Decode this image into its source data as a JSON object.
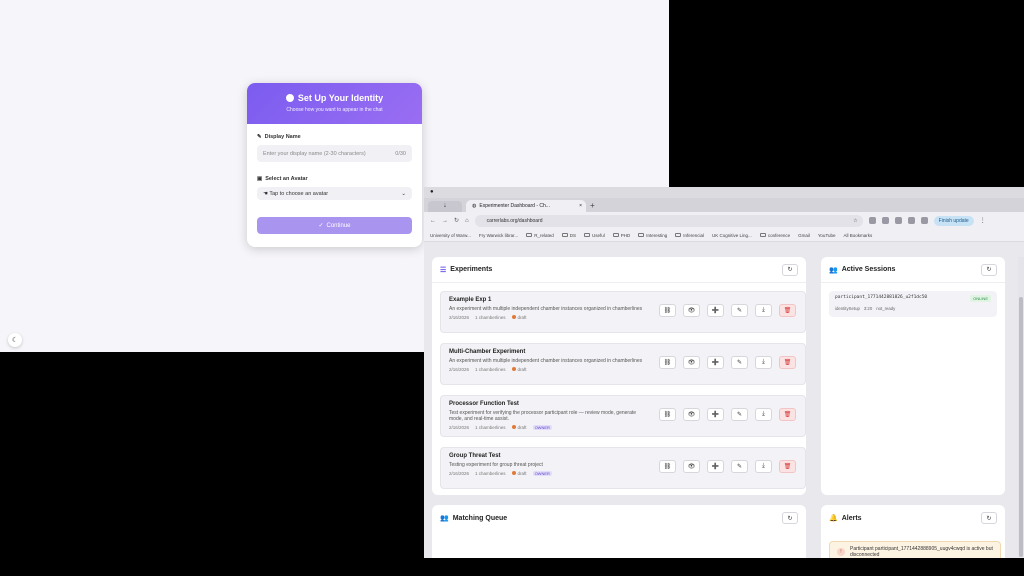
{
  "identity": {
    "title": "Set Up Your Identity",
    "subtitle": "Choose how you want to appear in the chat",
    "display_name_label": "Display Name",
    "display_name_placeholder": "Enter your display name (2-30 characters)",
    "char_count": "0/30",
    "avatar_label": "Select an Avatar",
    "avatar_value": "Tap to choose an avatar",
    "continue_label": "Continue"
  },
  "browser": {
    "tab_small": "⇣",
    "tab_title": "Experimenter Dashboard - Ch...",
    "url": "carrerlabs.org/dashboard",
    "finish_update": "Finish update",
    "bookmarks": [
      "University of Warw...",
      "Fry Warwick librar...",
      "R_related",
      "DS",
      "Useful",
      "PHD",
      "Interesting",
      "Inferencial",
      "UK Cognitive Ling...",
      "conference",
      "Gmail",
      "YouTube"
    ],
    "all_bookmarks": "All Bookmarks"
  },
  "experiments": {
    "title": "Experiments",
    "items": [
      {
        "name": "Example Exp 1",
        "desc": "An experiment with multiple independent chamber instances organized in chamberlines",
        "date": "2/16/2026",
        "chambers": "1 chamberlines",
        "status": "draft",
        "badge": ""
      },
      {
        "name": "Multi-Chamber Experiment",
        "desc": "An experiment with multiple independent chamber instances organized in chamberlines",
        "date": "2/16/2026",
        "chambers": "1 chamberlines",
        "status": "draft",
        "badge": ""
      },
      {
        "name": "Processor Function Test",
        "desc": "Test experiment for verifying the processor participant role — review mode, generate mode, and real-time assist.",
        "date": "2/16/2026",
        "chambers": "1 chamberlines",
        "status": "draft",
        "badge": "OWNER"
      },
      {
        "name": "Group Threat Test",
        "desc": "Testing experiment for group threat project",
        "date": "2/16/2026",
        "chambers": "1 chamberlines",
        "status": "draft",
        "badge": "OWNER"
      }
    ]
  },
  "sessions": {
    "title": "Active Sessions",
    "session_id": "participant_1771442881826_u2f1dc50",
    "status": "ONLINE",
    "meta1": "identitySetup",
    "meta2": "3:20",
    "meta3": "not_ready"
  },
  "queue": {
    "title": "Matching Queue"
  },
  "alerts": {
    "title": "Alerts",
    "message": "Participant participant_1771442888905_uugv4cwqd is active but disconnected"
  }
}
